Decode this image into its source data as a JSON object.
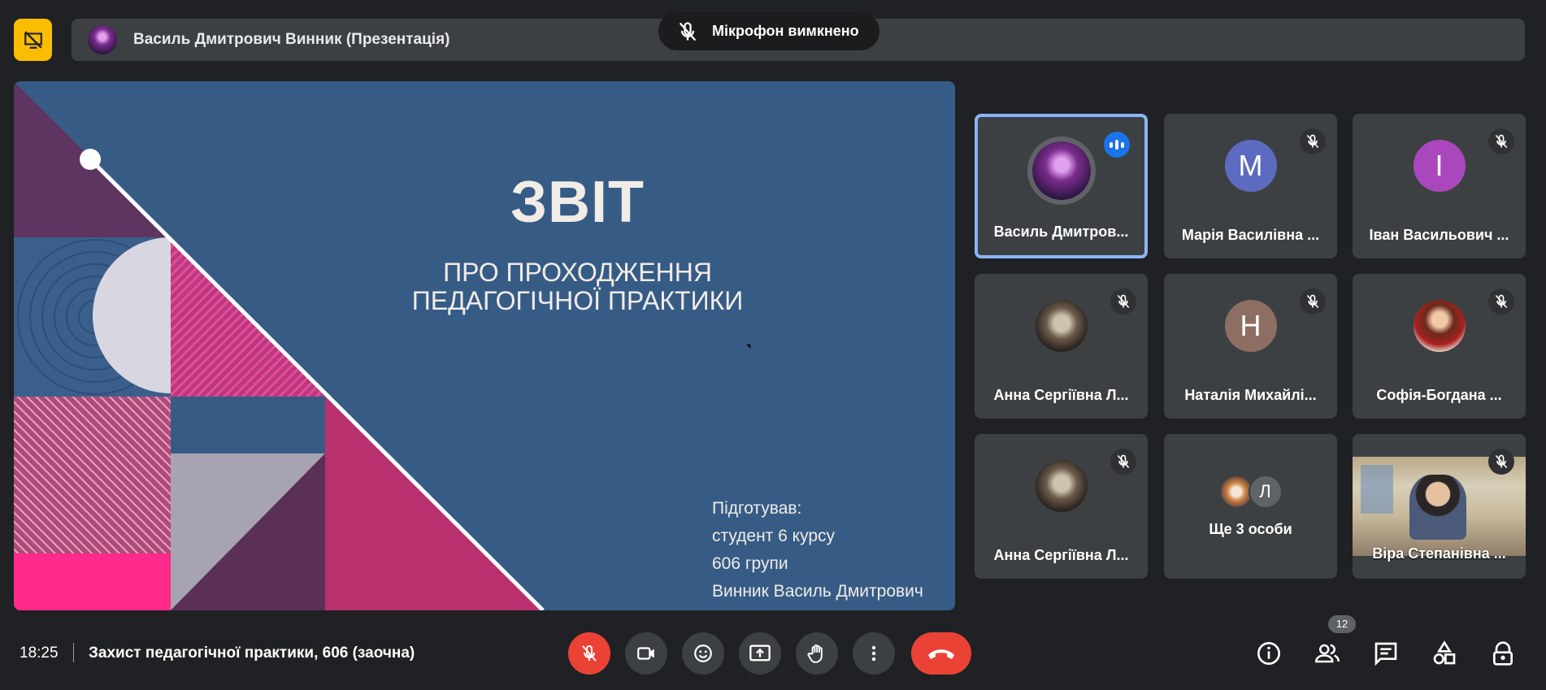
{
  "header": {
    "presenter_title": "Василь Дмитрович Винник (Презентація)",
    "mic_toast": "Мікрофон вимкнено"
  },
  "slide": {
    "title": "ЗВІТ",
    "subtitle": "ПРО ПРОХОДЖЕННЯ\nПЕДАГОГІЧНОЇ ПРАКТИКИ",
    "author_lines": [
      "Підготував:",
      "студент 6 курсу",
      "606 групи",
      "Винник Василь Дмитрович"
    ]
  },
  "participants": [
    {
      "name": "Василь Дмитров...",
      "state": "speaking",
      "avatar": "photo"
    },
    {
      "name": "Марія Василівна ...",
      "state": "muted",
      "initial": "М",
      "color": "#5c6bc0"
    },
    {
      "name": "Іван Васильович ...",
      "state": "muted",
      "initial": "І",
      "color": "#ab47bc"
    },
    {
      "name": "Анна Сергіївна Л...",
      "state": "muted",
      "avatar": "photo"
    },
    {
      "name": "Наталія Михайлі...",
      "state": "muted",
      "initial": "Н",
      "color": "#8d6e63"
    },
    {
      "name": "Софія-Богдана ...",
      "state": "muted",
      "avatar": "photo"
    },
    {
      "name": "Анна Сергіївна Л...",
      "state": "muted",
      "avatar": "photo"
    },
    {
      "name": "Ще 3 особи",
      "state": "more",
      "initial": "Л"
    },
    {
      "name": "Віра Степанівна ...",
      "state": "muted",
      "avatar": "video"
    }
  ],
  "footer": {
    "time": "18:25",
    "meeting_name": "Захист педагогічної практики, 606 (заочна)",
    "participants_count": "12"
  },
  "colors": {
    "accent_yellow": "#fbbc04",
    "hangup_red": "#ea4335",
    "active_border": "#8ab4f8",
    "slide_bg": "#365c86"
  },
  "icons": [
    "present-off-icon",
    "mic-off-icon",
    "videocam-icon",
    "emoji-icon",
    "present-icon",
    "hand-icon",
    "more-vert-icon",
    "call-end-icon",
    "info-icon",
    "people-icon",
    "chat-icon",
    "activities-icon",
    "host-controls-icon"
  ]
}
